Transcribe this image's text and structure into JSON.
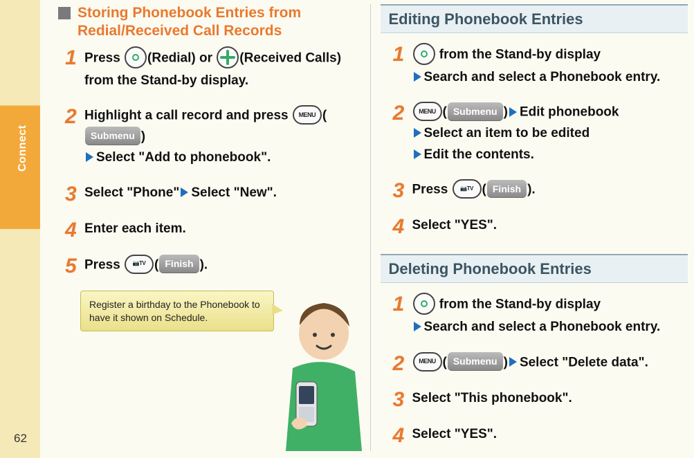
{
  "page_number": "62",
  "side_label": "Connect",
  "left": {
    "heading_lines": [
      "Storing Phonebook Entries from",
      "Redial/Received Call Records"
    ],
    "steps": [
      {
        "parts": [
          {
            "t": "text",
            "v": "Press "
          },
          {
            "t": "btn",
            "icon": "circle-outline"
          },
          {
            "t": "text",
            "v": "(Redial) or "
          },
          {
            "t": "btn",
            "icon": "four-way"
          },
          {
            "t": "text",
            "v": "(Received Calls) from the Stand-by display."
          }
        ]
      },
      {
        "parts": [
          {
            "t": "text",
            "v": "Highlight a call record and press "
          },
          {
            "t": "btn",
            "label": "MENU",
            "tiny": true
          },
          {
            "t": "text",
            "v": "("
          },
          {
            "t": "chip",
            "v": "Submenu"
          },
          {
            "t": "text",
            "v": ")"
          },
          {
            "t": "br"
          },
          {
            "t": "arrow"
          },
          {
            "t": "text",
            "v": "Select \"Add to phonebook\"."
          }
        ]
      },
      {
        "parts": [
          {
            "t": "text",
            "v": "Select \"Phone\""
          },
          {
            "t": "arrow"
          },
          {
            "t": "text",
            "v": "Select \"New\"."
          }
        ]
      },
      {
        "parts": [
          {
            "t": "text",
            "v": "Enter each item."
          }
        ]
      },
      {
        "parts": [
          {
            "t": "text",
            "v": "Press "
          },
          {
            "t": "btn",
            "label": "📷TV",
            "tiny": true
          },
          {
            "t": "text",
            "v": "("
          },
          {
            "t": "chip",
            "v": "Finish"
          },
          {
            "t": "text",
            "v": ")."
          }
        ]
      }
    ],
    "tip": "Register a birthday to the Phonebook to have it shown on Schedule."
  },
  "right": {
    "section1_title": "Editing Phonebook Entries",
    "section1_steps": [
      {
        "parts": [
          {
            "t": "btn",
            "icon": "circle-outline"
          },
          {
            "t": "text",
            "v": " from the Stand-by display"
          },
          {
            "t": "br"
          },
          {
            "t": "arrow"
          },
          {
            "t": "text",
            "v": "Search and select a Phonebook entry."
          }
        ]
      },
      {
        "parts": [
          {
            "t": "btn",
            "label": "MENU",
            "tiny": true
          },
          {
            "t": "text",
            "v": "("
          },
          {
            "t": "chip",
            "v": "Submenu"
          },
          {
            "t": "text",
            "v": ")"
          },
          {
            "t": "arrow"
          },
          {
            "t": "text",
            "v": "Edit phonebook"
          },
          {
            "t": "br"
          },
          {
            "t": "arrow"
          },
          {
            "t": "text",
            "v": "Select an item to be edited"
          },
          {
            "t": "br"
          },
          {
            "t": "arrow"
          },
          {
            "t": "text",
            "v": "Edit the contents."
          }
        ]
      },
      {
        "parts": [
          {
            "t": "text",
            "v": "Press "
          },
          {
            "t": "btn",
            "label": "📷TV",
            "tiny": true
          },
          {
            "t": "text",
            "v": "("
          },
          {
            "t": "chip",
            "v": "Finish"
          },
          {
            "t": "text",
            "v": ")."
          }
        ]
      },
      {
        "parts": [
          {
            "t": "text",
            "v": "Select \"YES\"."
          }
        ]
      }
    ],
    "section2_title": "Deleting Phonebook Entries",
    "section2_steps": [
      {
        "parts": [
          {
            "t": "btn",
            "icon": "circle-outline"
          },
          {
            "t": "text",
            "v": " from the Stand-by display"
          },
          {
            "t": "br"
          },
          {
            "t": "arrow"
          },
          {
            "t": "text",
            "v": "Search and select a Phonebook entry."
          }
        ]
      },
      {
        "parts": [
          {
            "t": "btn",
            "label": "MENU",
            "tiny": true
          },
          {
            "t": "text",
            "v": "("
          },
          {
            "t": "chip",
            "v": "Submenu"
          },
          {
            "t": "text",
            "v": ")"
          },
          {
            "t": "arrow"
          },
          {
            "t": "text",
            "v": "Select \"Delete data\"."
          }
        ]
      },
      {
        "parts": [
          {
            "t": "text",
            "v": "Select \"This phonebook\"."
          }
        ]
      },
      {
        "parts": [
          {
            "t": "text",
            "v": "Select \"YES\"."
          }
        ]
      }
    ]
  }
}
